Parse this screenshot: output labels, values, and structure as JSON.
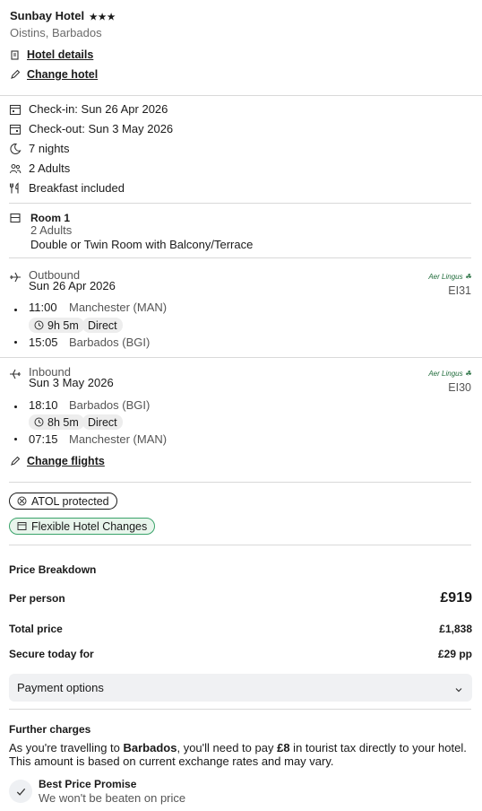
{
  "hotel": {
    "name": "Sunbay Hotel",
    "stars": "★★★",
    "location": "Oistins, Barbados",
    "details_link": "Hotel details",
    "change_link": "Change hotel"
  },
  "stay": {
    "checkin": "Check-in: Sun 26 Apr 2026",
    "checkout": "Check-out: Sun 3 May 2026",
    "nights": "7 nights",
    "guests": "2 Adults",
    "board": "Breakfast included"
  },
  "room": {
    "title": "Room 1",
    "guests": "2 Adults",
    "type": "Double or Twin Room with Balcony/Terrace"
  },
  "flights": {
    "outbound": {
      "label": "Outbound",
      "date": "Sun 26 Apr 2026",
      "airline": "Aer Lingus",
      "flight_no": "EI31",
      "depart_time": "11:00",
      "depart_airport": "Manchester (MAN)",
      "duration": "9h 5m",
      "stops": "Direct",
      "arrive_time": "15:05",
      "arrive_airport": "Barbados (BGI)"
    },
    "inbound": {
      "label": "Inbound",
      "date": "Sun 3 May 2026",
      "airline": "Aer Lingus",
      "flight_no": "EI30",
      "depart_time": "18:10",
      "depart_airport": "Barbados (BGI)",
      "duration": "8h 5m",
      "stops": "Direct",
      "arrive_time": "07:15",
      "arrive_airport": "Manchester (MAN)"
    },
    "change_link": "Change flights"
  },
  "badges": {
    "atol": "ATOL protected",
    "flexible": "Flexible Hotel Changes"
  },
  "price": {
    "heading": "Price Breakdown",
    "per_person_label": "Per person",
    "per_person_value": "£919",
    "total_label": "Total price",
    "total_value": "£1,838",
    "secure_label": "Secure today for",
    "secure_value": "£29 pp",
    "payment_options": "Payment options"
  },
  "further": {
    "heading": "Further charges",
    "text_1": "As you're travelling to ",
    "destination": "Barbados",
    "text_2": ", you'll need to pay ",
    "amount": "£8",
    "text_3": " in tourist tax directly to your hotel.",
    "text_4": "This amount is based on current exchange rates and may vary."
  },
  "promise": {
    "title": "Best Price Promise",
    "subtitle": "We won't be beaten on price"
  },
  "colors": {
    "divider": "#d9d9d9",
    "flexible_border": "#3aa36a",
    "flexible_bg": "#e8f5ec",
    "pill_bg": "#ededed",
    "payment_bg": "#f0f1f3"
  }
}
